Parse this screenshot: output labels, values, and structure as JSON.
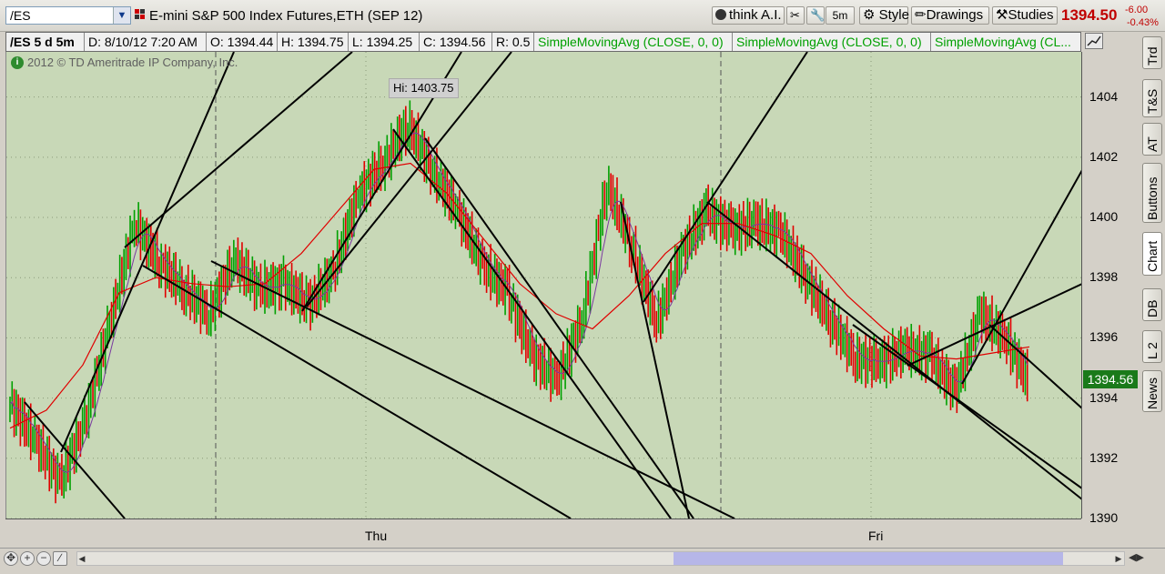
{
  "toolbar": {
    "symbol": "/ES",
    "instrument_title": "E-mini S&P 500 Index Futures,ETH (SEP 12)",
    "think_ai": "think A.I.",
    "timeframe": "5m",
    "style": "Style",
    "drawings": "Drawings",
    "studies": "Studies",
    "last_price": "1394.50",
    "change": "-6.00",
    "change_pct": "-0.43%"
  },
  "info": {
    "symbol_period": "/ES 5 d 5m",
    "date": "D: 8/10/12 7:20 AM",
    "open": "O: 1394.44",
    "high": "H: 1394.75",
    "low": "L: 1394.25",
    "close": "C: 1394.56",
    "range": "R: 0.5",
    "sma1": "SimpleMovingAvg (CLOSE, 0, 0)",
    "sma2": "SimpleMovingAvg (CLOSE, 0, 0)",
    "sma3": "SimpleMovingAvg (CL..."
  },
  "chart": {
    "copyright": "2012 © TD Ameritrade IP Company, Inc.",
    "hi_label": "Hi: 1403.75",
    "last_marker": "1394.56",
    "y_ticks": [
      "1404",
      "1402",
      "1400",
      "1398",
      "1396",
      "1394",
      "1392",
      "1390"
    ],
    "x_labels": [
      "Thu",
      "Fri"
    ]
  },
  "side_tabs": [
    "Trd",
    "T&S",
    "AT",
    "Buttons",
    "Chart",
    "DB",
    "L 2",
    "News"
  ],
  "colors": {
    "chart_bg": "#c8d8b7",
    "up_bar": "#00a000",
    "down_bar": "#e00000",
    "sma_fast": "#7a3aa0",
    "sma_slow": "#e00000",
    "trendline": "#000000",
    "price_red": "#c00000"
  },
  "chart_data": {
    "type": "line",
    "ylim": [
      1390,
      1405.5
    ],
    "x_categories": [
      "Thu",
      "Fri"
    ],
    "series": [
      {
        "values": [
          1393.8,
          1392.6,
          1391.2,
          1393.2,
          1396.5,
          1399.8,
          1398.5,
          1397.6,
          1396.8,
          1398.6,
          1397.6,
          1397.8,
          1397.1,
          1398.2,
          1400.8,
          1401.8,
          1403.1,
          1401.5,
          1400.2,
          1398.4,
          1397.5,
          1395.4,
          1394.6,
          1396.6,
          1401.1,
          1399.0,
          1396.5,
          1398.8,
          1400.2,
          1399.6,
          1399.8,
          1399.5,
          1398.0,
          1396.6,
          1395.3,
          1395.2,
          1395.6,
          1395.4,
          1394.2,
          1396.8,
          1396.0,
          1394.5
        ]
      },
      {
        "values": [
          1393.0,
          1393.6,
          1395.1,
          1397.5,
          1398.0,
          1397.8,
          1397.7,
          1397.8,
          1398.8,
          1400.2,
          1401.6,
          1401.8,
          1400.8,
          1399.3,
          1397.8,
          1396.8,
          1396.3,
          1397.4,
          1398.8,
          1399.8,
          1399.8,
          1399.4,
          1398.8,
          1397.4,
          1396.3,
          1395.4,
          1395.3,
          1395.5,
          1395.7
        ]
      }
    ]
  }
}
